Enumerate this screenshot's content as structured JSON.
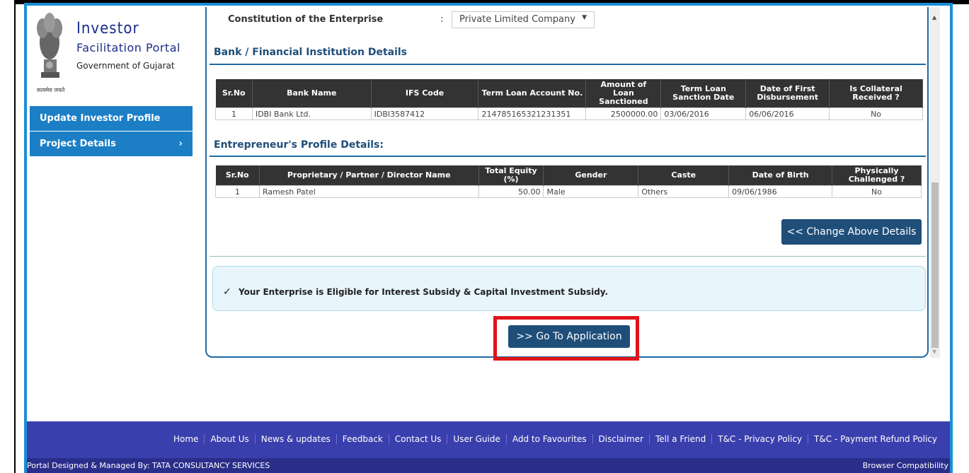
{
  "logo": {
    "title": "Investor",
    "subtitle": "Facilitation Portal",
    "org": "Government of Gujarat",
    "motto": "सत्यमेव जयते"
  },
  "sidebar": {
    "items": [
      {
        "label": "Update Investor Profile"
      },
      {
        "label": "Project Details",
        "chevron": "›"
      }
    ]
  },
  "constitution": {
    "label": "Constitution of the Enterprise",
    "colon": ":",
    "value": "Private Limited Company",
    "arrow": "▼"
  },
  "bank": {
    "title": "Bank / Financial Institution Details",
    "headers": [
      "Sr.No",
      "Bank Name",
      "IFS Code",
      "Term Loan Account No.",
      "Amount of Loan Sanctioned",
      "Term Loan Sanction Date",
      "Date of First Disbursement",
      "Is Collateral Received ?"
    ],
    "rows": [
      [
        "1",
        "IDBI Bank Ltd.",
        "IDBI3587412",
        "214785165321231351",
        "2500000.00",
        "03/06/2016",
        "06/06/2016",
        "No"
      ]
    ]
  },
  "entrepreneur": {
    "title": "Entrepreneur's Profile Details:",
    "headers": [
      "Sr.No",
      "Proprietary / Partner / Director Name",
      "Total Equity (%)",
      "Gender",
      "Caste",
      "Date of Birth",
      "Physically Challenged ?"
    ],
    "rows": [
      [
        "1",
        "Ramesh Patel",
        "50.00",
        "Male",
        "Others",
        "09/06/1986",
        "No"
      ]
    ]
  },
  "buttons": {
    "change": "<< Change Above Details",
    "goto": ">> Go To Application"
  },
  "alert": {
    "check": "✓",
    "message": "Your Enterprise is Eligible for Interest Subsidy & Capital Investment Subsidy."
  },
  "footer": {
    "links": [
      "Home",
      "About Us",
      "News & updates",
      "Feedback",
      "Contact Us",
      "User Guide",
      "Add to Favourites",
      "Disclaimer",
      "Tell a Friend",
      "T&C - Privacy Policy",
      "T&C - Payment Refund Policy"
    ],
    "credit": "Portal Designed & Managed By: TATA CONSULTANCY SERVICES",
    "compat": "Browser Compatibility"
  },
  "colors": {
    "accent": "#1c7fc6",
    "navy": "#1f4e79",
    "footer": "#3a3fae",
    "highlight": "#e0141a"
  }
}
